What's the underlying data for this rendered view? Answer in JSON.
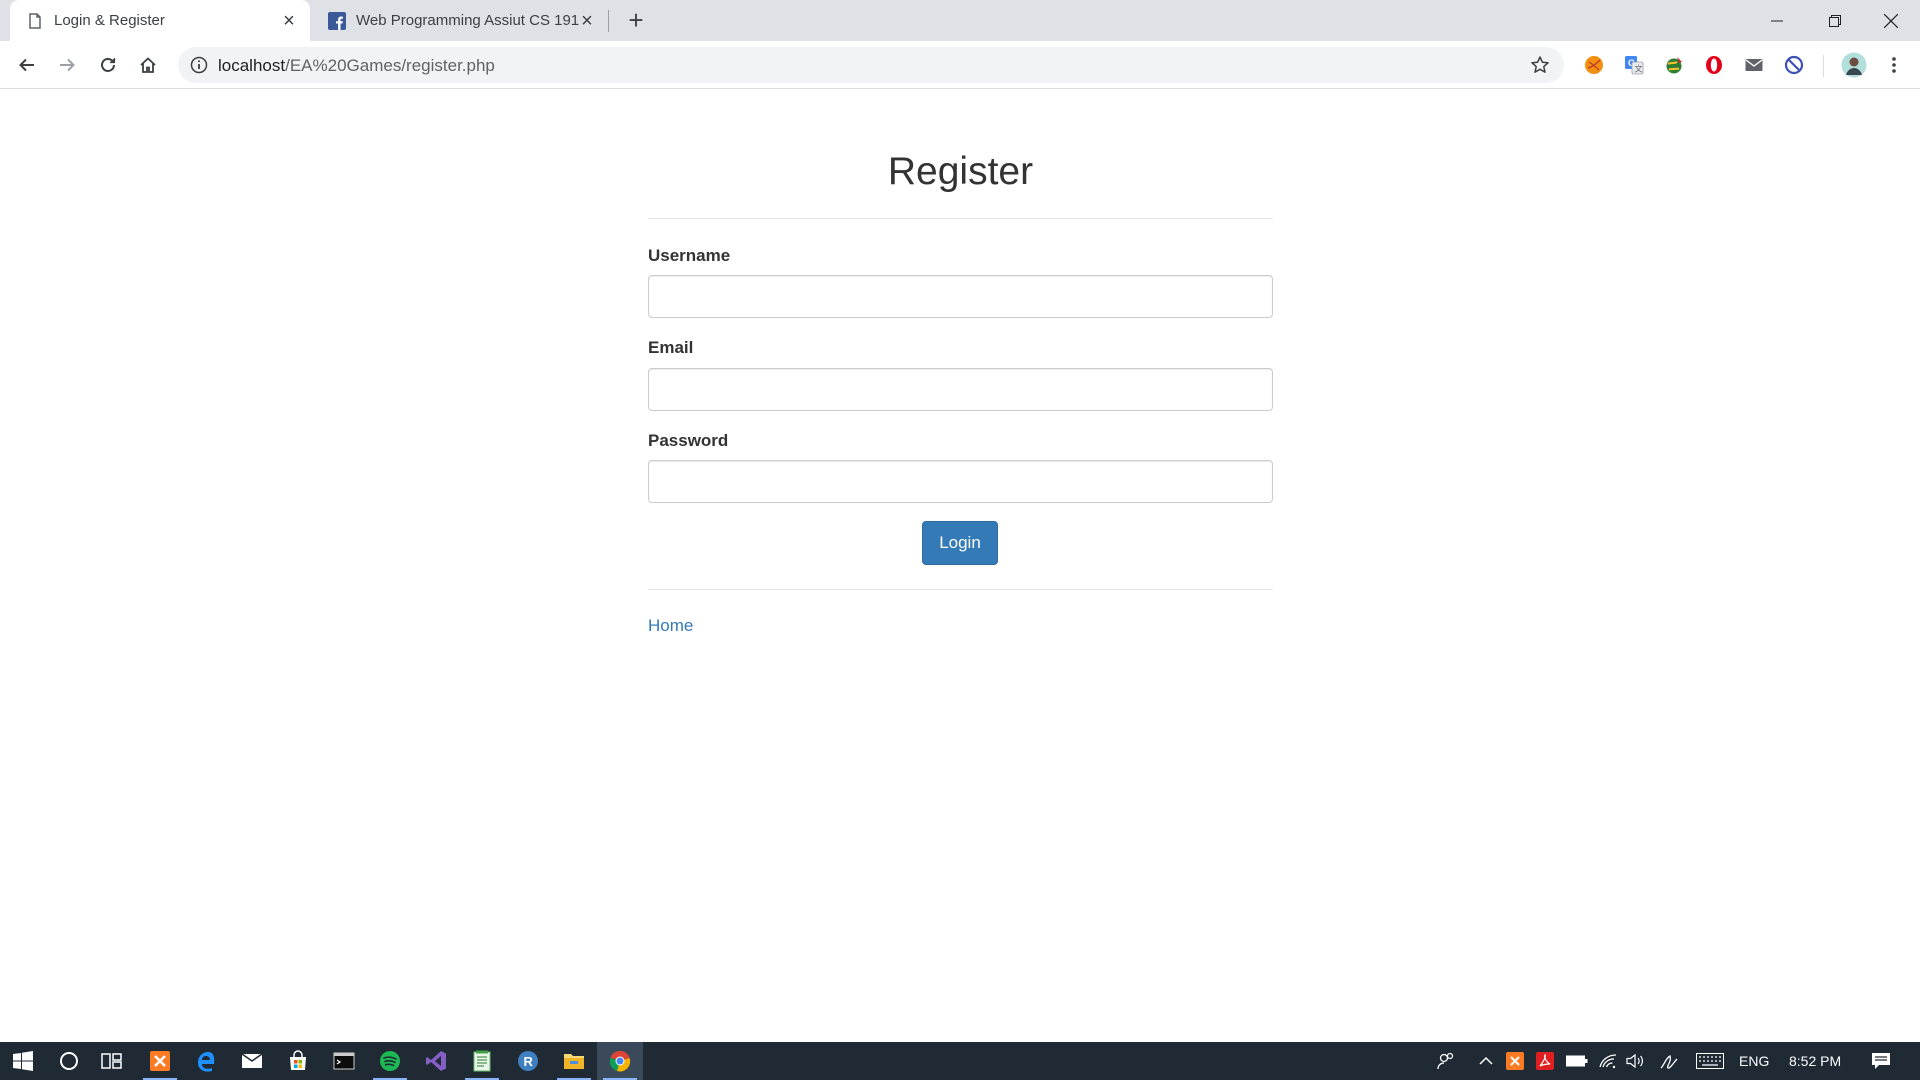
{
  "browser": {
    "tabs": [
      {
        "title": "Login & Register",
        "favicon": "page-icon",
        "active": true
      },
      {
        "title": "Web Programming Assiut CS 191",
        "favicon": "facebook-icon",
        "active": false
      }
    ],
    "new_tab_icon": "plus-icon",
    "url_host": "localhost",
    "url_path": "/EA%20Games/register.php",
    "extensions": [
      "orange-circle-extension-icon",
      "translate-extension-icon",
      "globe-extension-icon",
      "opera-extension-icon",
      "mail-extension-icon",
      "block-extension-icon"
    ],
    "profile_icon": "avatar-icon"
  },
  "page": {
    "heading": "Register",
    "username_label": "Username",
    "username_value": "",
    "email_label": "Email",
    "email_value": "",
    "password_label": "Password",
    "password_value": "",
    "submit_label": "Login",
    "home_link": "Home"
  },
  "taskbar": {
    "apps": [
      "start-icon",
      "cortana-icon",
      "task-view-icon",
      "xampp-icon",
      "edge-icon",
      "mail-icon",
      "store-icon",
      "terminal-icon",
      "spotify-icon",
      "visual-studio-icon",
      "notepad-icon",
      "r-studio-icon",
      "file-explorer-icon",
      "chrome-icon"
    ],
    "language": "ENG",
    "time": "8:52 PM"
  },
  "colors": {
    "primary_button": "#337ab7",
    "link": "#337ab7",
    "tabstrip": "#dee1e6",
    "taskbar": "#1f2a35"
  }
}
